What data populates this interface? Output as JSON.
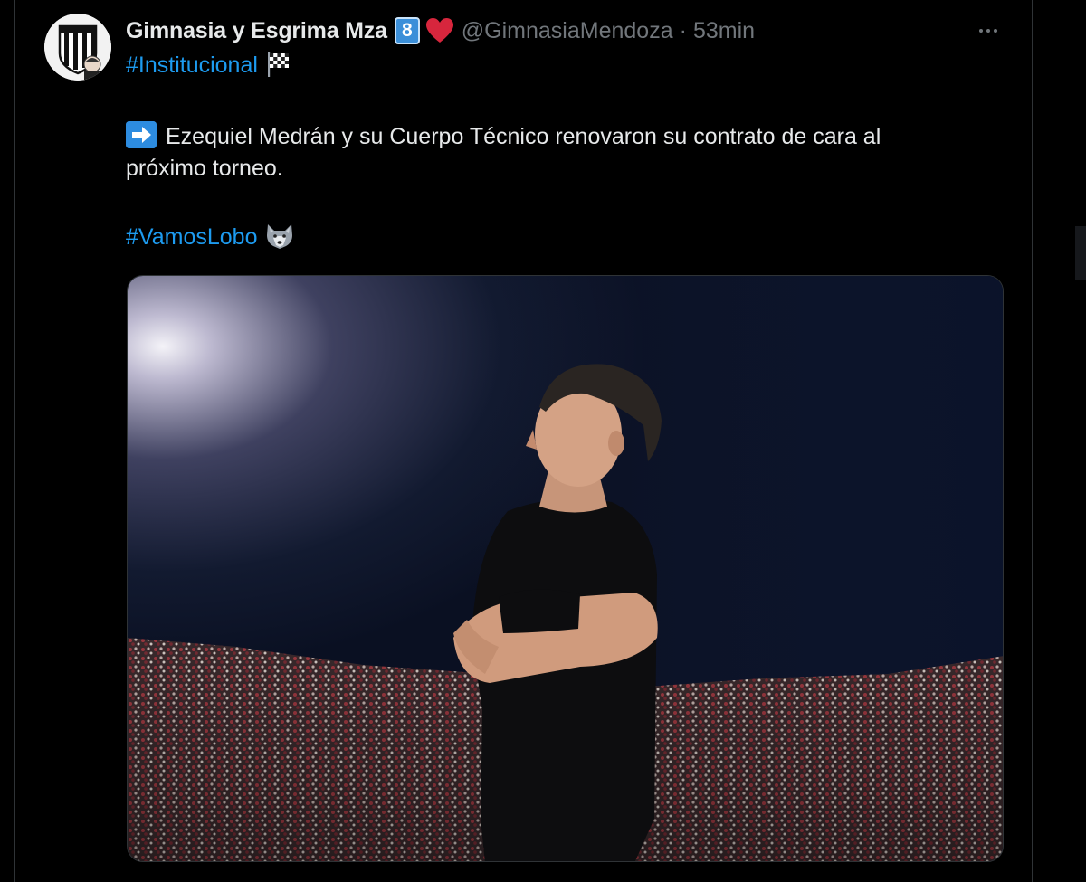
{
  "tweet": {
    "display_name": "Gimnasia y Esgrima Mza",
    "badge_number": "8",
    "handle": "@GimnasiaMendoza",
    "separator": "·",
    "time": "53min",
    "hashtag_top": "#Institucional",
    "body_line_1": "Ezequiel Medrán y su Cuerpo Técnico renovaron su contrato de cara al",
    "body_line_2": "próximo torneo.",
    "hashtag_bottom": "#VamosLobo"
  },
  "icons": {
    "badge": "number-8-emoji-icon",
    "heart": "red-heart-emoji-icon",
    "more": "more-options-icon",
    "flag": "chequered-flag-emoji-icon",
    "arrow": "right-arrow-emoji-icon",
    "wolf": "wolf-emoji-icon"
  },
  "colors": {
    "background": "#000000",
    "text": "#e7e9ea",
    "secondary_text": "#71767b",
    "link": "#1d9bf0",
    "heart": "#d7263d",
    "badge": "#3b8fd9"
  },
  "media": {
    "type": "photo",
    "subject": "coach-standing-arms-crossed-in-stadium"
  }
}
